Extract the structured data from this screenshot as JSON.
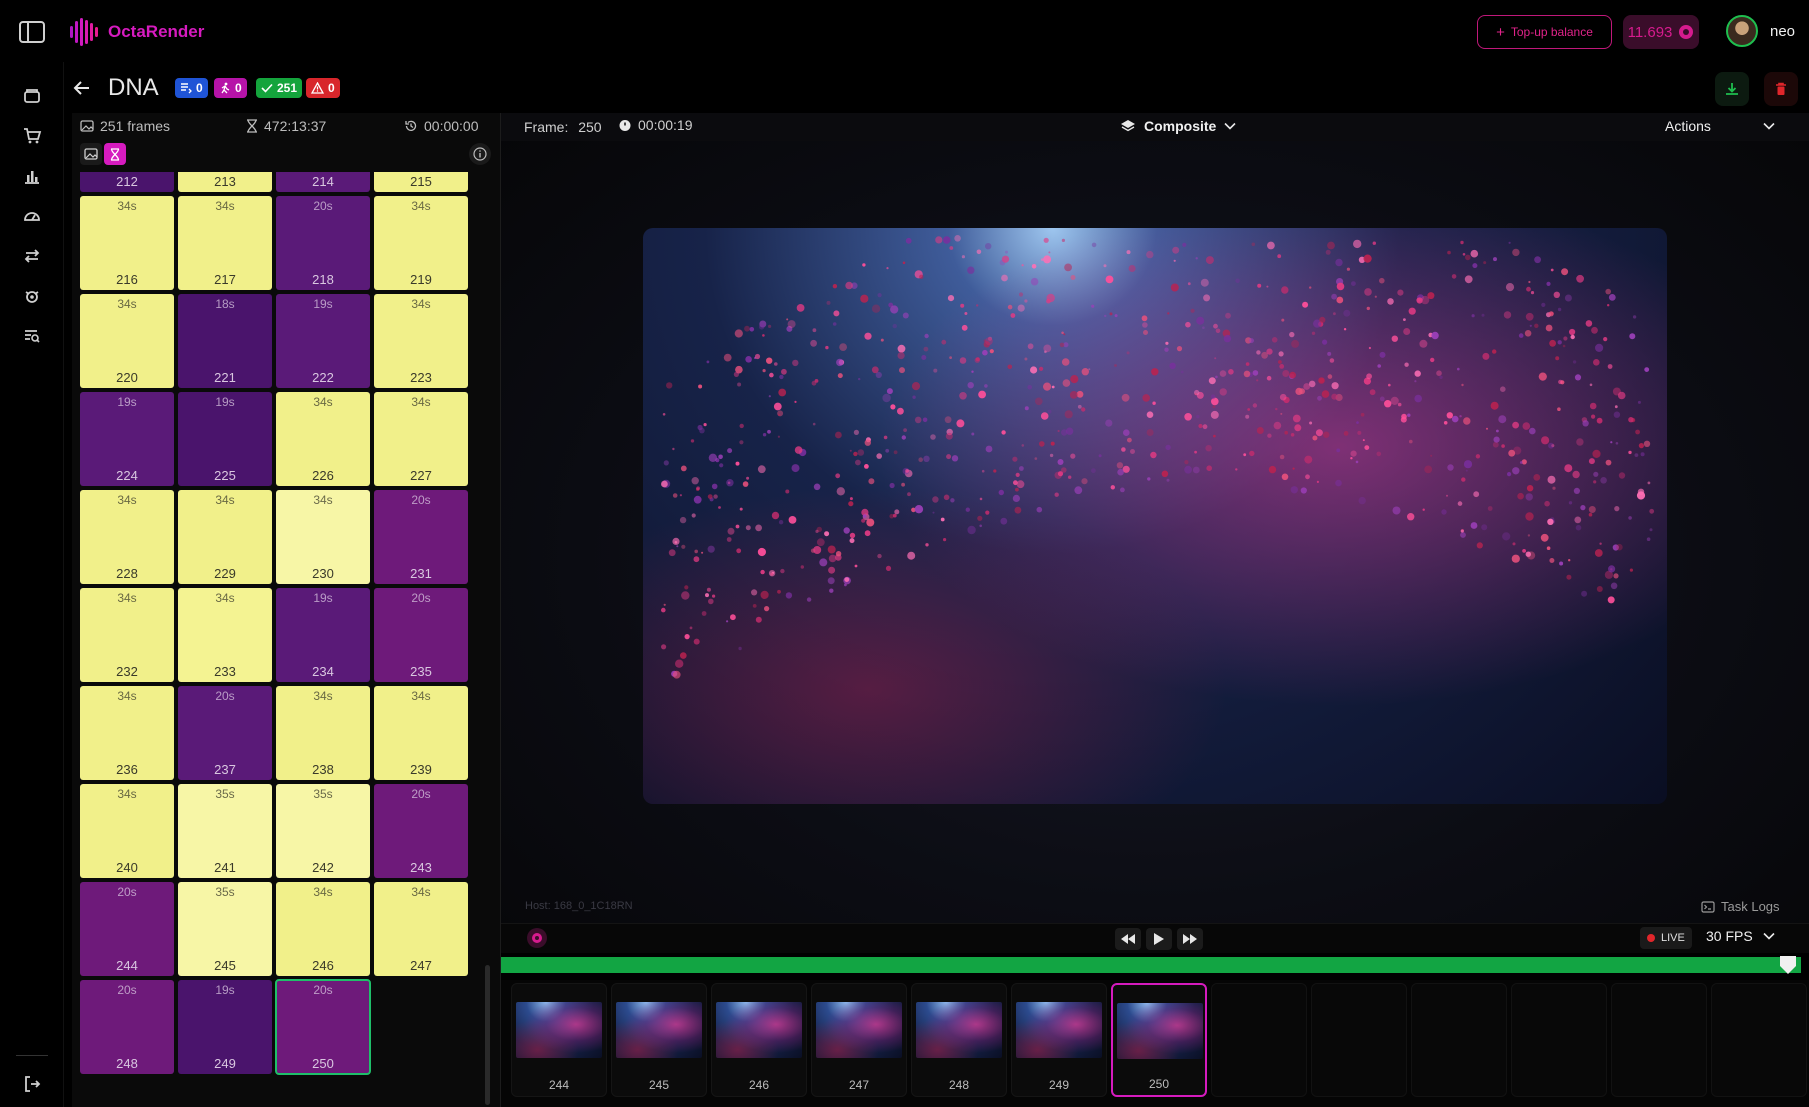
{
  "app": {
    "name": "OctaRender"
  },
  "header": {
    "topup_label": "Top-up balance",
    "balance": "11.693",
    "username": "neo"
  },
  "nav": {
    "icons": [
      "projects-icon",
      "cart-icon",
      "stats-icon",
      "dashboard-icon",
      "transfer-icon",
      "render-nodes-icon",
      "logs-search-icon"
    ],
    "logout_icon": "logout-icon"
  },
  "project": {
    "title": "DNA",
    "badges": {
      "queued": "0",
      "running": "0",
      "done": "251",
      "errors": "0"
    }
  },
  "frames_panel": {
    "frames_count": "251 frames",
    "total_time": "472:13:37",
    "elapsed": "00:00:00",
    "tiles": [
      {
        "num": "212",
        "dur": "",
        "kind": "short v2"
      },
      {
        "num": "213",
        "dur": "",
        "kind": "long"
      },
      {
        "num": "214",
        "dur": "",
        "kind": "short"
      },
      {
        "num": "215",
        "dur": "",
        "kind": "long"
      },
      {
        "num": "216",
        "dur": "34s",
        "kind": "long"
      },
      {
        "num": "217",
        "dur": "34s",
        "kind": "long"
      },
      {
        "num": "218",
        "dur": "20s",
        "kind": "short"
      },
      {
        "num": "219",
        "dur": "34s",
        "kind": "long"
      },
      {
        "num": "220",
        "dur": "34s",
        "kind": "long"
      },
      {
        "num": "221",
        "dur": "18s",
        "kind": "short v2"
      },
      {
        "num": "222",
        "dur": "19s",
        "kind": "short"
      },
      {
        "num": "223",
        "dur": "34s",
        "kind": "long"
      },
      {
        "num": "224",
        "dur": "19s",
        "kind": "short"
      },
      {
        "num": "225",
        "dur": "19s",
        "kind": "short v2"
      },
      {
        "num": "226",
        "dur": "34s",
        "kind": "long"
      },
      {
        "num": "227",
        "dur": "34s",
        "kind": "long"
      },
      {
        "num": "228",
        "dur": "34s",
        "kind": "long"
      },
      {
        "num": "229",
        "dur": "34s",
        "kind": "long"
      },
      {
        "num": "230",
        "dur": "34s",
        "kind": "long v3"
      },
      {
        "num": "231",
        "dur": "20s",
        "kind": "short v3"
      },
      {
        "num": "232",
        "dur": "34s",
        "kind": "long"
      },
      {
        "num": "233",
        "dur": "34s",
        "kind": "long v2"
      },
      {
        "num": "234",
        "dur": "19s",
        "kind": "short"
      },
      {
        "num": "235",
        "dur": "20s",
        "kind": "short v3"
      },
      {
        "num": "236",
        "dur": "34s",
        "kind": "long"
      },
      {
        "num": "237",
        "dur": "20s",
        "kind": "short"
      },
      {
        "num": "238",
        "dur": "34s",
        "kind": "long"
      },
      {
        "num": "239",
        "dur": "34s",
        "kind": "long"
      },
      {
        "num": "240",
        "dur": "34s",
        "kind": "long"
      },
      {
        "num": "241",
        "dur": "35s",
        "kind": "long v3"
      },
      {
        "num": "242",
        "dur": "35s",
        "kind": "long v3"
      },
      {
        "num": "243",
        "dur": "20s",
        "kind": "short v3"
      },
      {
        "num": "244",
        "dur": "20s",
        "kind": "short v3"
      },
      {
        "num": "245",
        "dur": "35s",
        "kind": "long v3"
      },
      {
        "num": "246",
        "dur": "34s",
        "kind": "long"
      },
      {
        "num": "247",
        "dur": "34s",
        "kind": "long"
      },
      {
        "num": "248",
        "dur": "20s",
        "kind": "short v3"
      },
      {
        "num": "249",
        "dur": "19s",
        "kind": "short v2"
      },
      {
        "num": "250",
        "dur": "20s",
        "kind": "short v3 selected"
      }
    ]
  },
  "viewer": {
    "frame_label": "Frame:",
    "frame_value": "250",
    "frame_time": "00:00:19",
    "mode": "Composite",
    "actions_label": "Actions",
    "host": "Host: 168_0_1C18RN",
    "task_logs": "Task Logs"
  },
  "player": {
    "live_label": "LIVE",
    "fps": "30 FPS",
    "progress": 0.99
  },
  "filmstrip": {
    "frames": [
      "244",
      "245",
      "246",
      "247",
      "248",
      "249",
      "250"
    ],
    "active": "250",
    "empty_slots": 6
  },
  "colors": {
    "accent": "#d61bbf",
    "success": "#12a543",
    "long_tile": "#f1f08a",
    "short_tile": "#5a1a78"
  }
}
